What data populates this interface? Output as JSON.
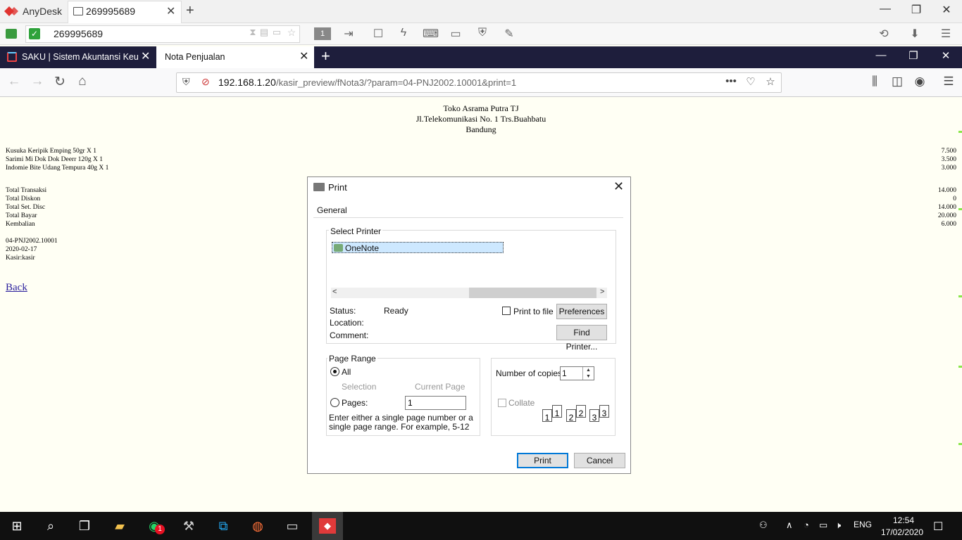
{
  "anydesk": {
    "app_name": "AnyDesk",
    "tab_label": "269995689",
    "address": "269995689",
    "toolbar_number": "1"
  },
  "firefox": {
    "tabs": [
      {
        "label": "SAKU | Sistem Akuntansi Keuan"
      },
      {
        "label": "Nota Penjualan"
      }
    ],
    "url_host": "192.168.1.20",
    "url_path": "/kasir_preview/fNota3/?param=04-PNJ2002.10001&print=1"
  },
  "receipt": {
    "store_name": "Toko Asrama Putra TJ",
    "address": "Jl.Telekomunikasi No. 1 Trs.Buahbatu",
    "city": "Bandung",
    "items": [
      {
        "name": "Kusuka Keripik Emping 50gr X 1",
        "amount": "7.500"
      },
      {
        "name": "Sarimi Mi Dok Dok Deerr 120g X 1",
        "amount": "3.500"
      },
      {
        "name": "Indomie Bite Udang Tempura 40g X 1",
        "amount": "3.000"
      }
    ],
    "totals": [
      {
        "label": "Total Transaksi",
        "amount": "14.000"
      },
      {
        "label": "Total Diskon",
        "amount": "0"
      },
      {
        "label": "Total Set. Disc",
        "amount": "14.000"
      },
      {
        "label": "Total Bayar",
        "amount": "20.000"
      },
      {
        "label": "Kembalian",
        "amount": "6.000"
      }
    ],
    "nota_no": "04-PNJ2002.10001",
    "date": "2020-02-17",
    "cashier": "Kasir:kasir",
    "back_link": "Back"
  },
  "print_dialog": {
    "title": "Print",
    "tab": "General",
    "select_printer_label": "Select Printer",
    "printer_name": "OneNote",
    "status_label": "Status:",
    "status_value": "Ready",
    "location_label": "Location:",
    "comment_label": "Comment:",
    "print_to_file_label": "Print to file",
    "preferences_label": "Preferences",
    "find_printer_label": "Find Printer...",
    "page_range_label": "Page Range",
    "all_label": "All",
    "selection_label": "Selection",
    "current_page_label": "Current Page",
    "pages_label": "Pages:",
    "pages_value": "1",
    "hint_text": "Enter either a single page number or a single page range.  For example, 5-12",
    "copies_label": "Number of copies:",
    "copies_value": "1",
    "collate_label": "Collate",
    "collate_pages": [
      "1",
      "1",
      "2",
      "2",
      "3",
      "3"
    ],
    "print_button": "Print",
    "cancel_button": "Cancel"
  },
  "taskbar": {
    "time": "12:54",
    "date": "17/02/2020",
    "language": "ENG",
    "whatsapp_badge": "1"
  }
}
